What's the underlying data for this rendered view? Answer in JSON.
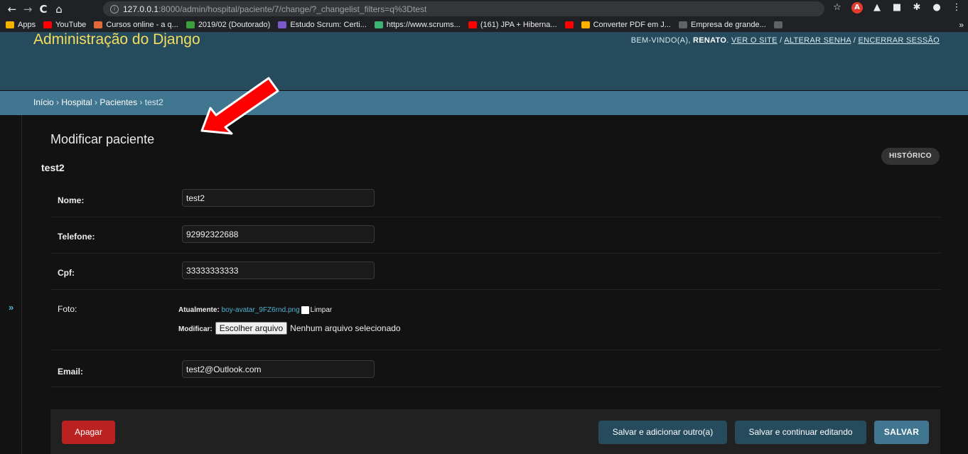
{
  "browser": {
    "back": "←",
    "forward": "→",
    "reload": "C",
    "home": "⌂",
    "url_host": "127.0.0.1",
    "url_path": ":8000/admin/hospital/paciente/7/change/?_changelist_filters=q%3Dtest",
    "star": "☆"
  },
  "bookmarks": {
    "items": [
      {
        "label": "Apps",
        "color": "#f4b400"
      },
      {
        "label": "YouTube",
        "color": "#ff0000"
      },
      {
        "label": "Cursos online - a q...",
        "color": "#e06a3a"
      },
      {
        "label": "2019/02 (Doutorado)",
        "color": "#3c9e3c"
      },
      {
        "label": "Estudo Scrum: Certi...",
        "color": "#7a5acb"
      },
      {
        "label": "https://www.scrums...",
        "color": "#3cb371"
      },
      {
        "label": "(161) JPA + Hiberna...",
        "color": "#ff0000"
      },
      {
        "label": "",
        "color": "#ff0000"
      },
      {
        "label": "Converter PDF em J...",
        "color": "#ffb000"
      },
      {
        "label": "Empresa de grande...",
        "color": "#5f6368"
      },
      {
        "label": "",
        "color": "#5f6368"
      }
    ],
    "more": "»"
  },
  "header": {
    "branding": "Administração do Django",
    "welcome": "BEM-VINDO(A),",
    "user": "RENATO",
    "view_site": "VER O SITE",
    "change_password": "ALTERAR SENHA",
    "logout": "ENCERRAR SESSÃO"
  },
  "breadcrumbs": {
    "home": "Início",
    "app": "Hospital",
    "model": "Pacientes",
    "current": "test2",
    "sep": " › "
  },
  "sidebar": {
    "toggle": "»"
  },
  "main": {
    "title": "Modificar paciente",
    "object_name": "test2",
    "history": "HISTÓRICO"
  },
  "form": {
    "nome": {
      "label": "Nome:",
      "value": "test2"
    },
    "telefone": {
      "label": "Telefone:",
      "value": "92992322688"
    },
    "cpf": {
      "label": "Cpf:",
      "value": "33333333333"
    },
    "foto": {
      "label": "Foto:",
      "current_label": "Atualmente:",
      "current_file": "boy-avatar_9FZ6rnd.png",
      "clear_label": "Limpar",
      "change_label": "Modificar:",
      "choose_button": "Escolher arquivo",
      "no_file": "Nenhum arquivo selecionado"
    },
    "email": {
      "label": "Email:",
      "value": "test2@Outlook.com"
    }
  },
  "submit": {
    "delete": "Apagar",
    "save_add": "Salvar e adicionar outro(a)",
    "save_continue": "Salvar e continuar editando",
    "save": "SALVAR"
  },
  "colors": {
    "header": "#264b5d",
    "breadcrumbs": "#417690",
    "branding": "#f5dd5d",
    "delete": "#ba2121",
    "link": "#4fb2d3",
    "annotation_arrow": "#ff0000"
  }
}
